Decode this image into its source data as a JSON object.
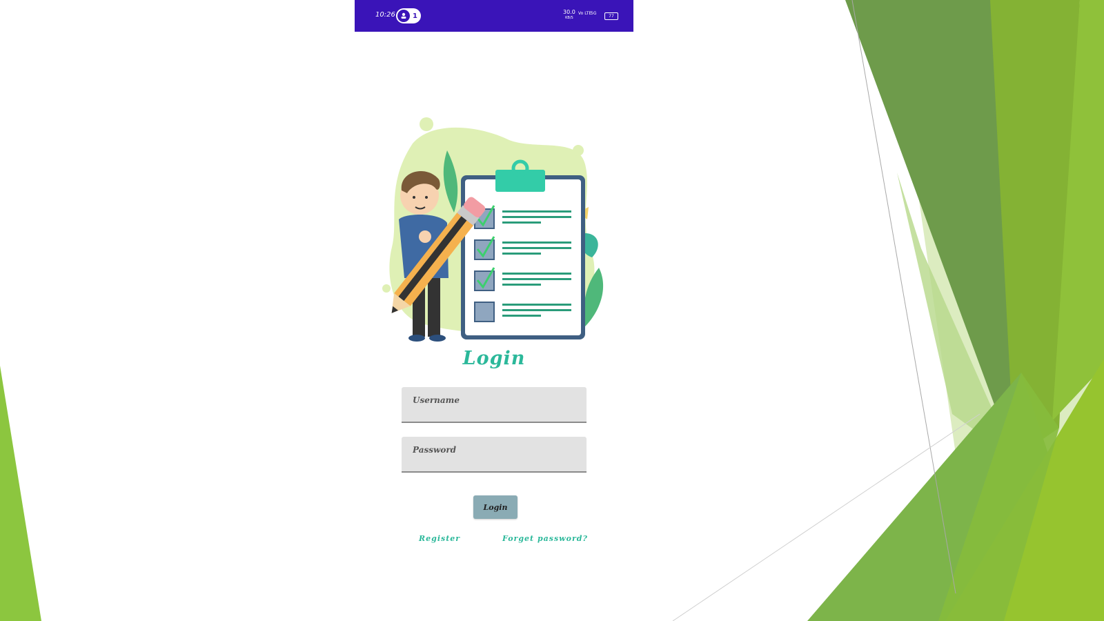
{
  "status_bar": {
    "time": "10:26",
    "hotspot_count": "1",
    "net_speed": "30.0",
    "net_unit": "KB/S",
    "volte": "Vo LTE",
    "signal": "5G",
    "battery": "77",
    "background_color": "#3a14b8"
  },
  "login": {
    "title": "Login",
    "username_placeholder": "Username",
    "password_placeholder": "Password",
    "button_label": "Login",
    "register_link": "Register",
    "forgot_link": "Forget password?"
  },
  "colors": {
    "accent": "#2bb89a",
    "button": "#8aabb4",
    "slide_green_dark": "#6b9b3a",
    "slide_green_light": "#8cc63f"
  }
}
